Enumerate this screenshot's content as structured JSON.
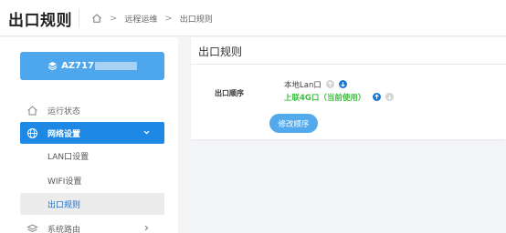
{
  "header": {
    "title": "出口规则",
    "breadcrumb": [
      "远程运维",
      "出口规则"
    ]
  },
  "sidebar": {
    "device_label": "AZ717",
    "items": [
      {
        "label": "运行状态"
      },
      {
        "label": "网络设置"
      },
      {
        "label": "系统路由"
      }
    ],
    "subitems": [
      {
        "label": "LAN口设置"
      },
      {
        "label": "WIFI设置"
      },
      {
        "label": "出口规则"
      }
    ]
  },
  "main": {
    "title": "出口规则",
    "row_label": "出口顺序",
    "ports": [
      {
        "label": "本地Lan口"
      },
      {
        "label": "上联4G口（当前使用）"
      }
    ],
    "button_label": "修改顺序"
  },
  "colors": {
    "accent": "#1e88e5",
    "device_button": "#4ea6ec",
    "active_port": "#3bbd3b",
    "button": "#52a9ec"
  },
  "icons": [
    "home-icon",
    "layers-icon",
    "dashboard-icon",
    "globe-icon",
    "router-icon",
    "chevron-down-icon",
    "chevron-right-icon",
    "arrow-up-icon",
    "arrow-down-icon"
  ]
}
